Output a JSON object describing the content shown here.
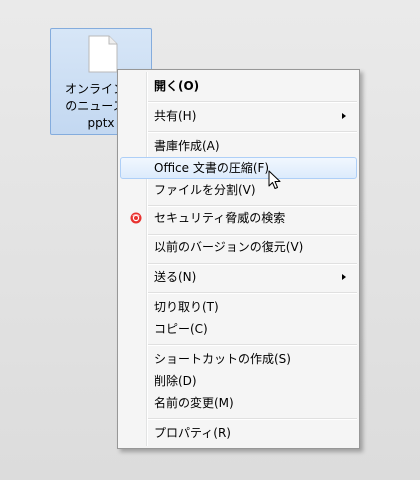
{
  "file": {
    "icon": "document-icon",
    "name_lines": [
      "オンラインソ",
      "のニュースサ",
      "pptx"
    ]
  },
  "context_menu": {
    "items": [
      {
        "label": "開く(O)",
        "bold": true
      },
      {
        "label": "共有(H)",
        "submenu": true
      },
      {
        "label": "書庫作成(A)"
      },
      {
        "label": "Office 文書の圧縮(F)",
        "highlighted": true
      },
      {
        "label": "ファイルを分割(V)"
      },
      {
        "label": "セキュリティ脅威の検索",
        "icon": "security-scan-icon"
      },
      {
        "label": "以前のバージョンの復元(V)"
      },
      {
        "label": "送る(N)",
        "submenu": true
      },
      {
        "label": "切り取り(T)"
      },
      {
        "label": "コピー(C)"
      },
      {
        "label": "ショートカットの作成(S)"
      },
      {
        "label": "削除(D)"
      },
      {
        "label": "名前の変更(M)"
      },
      {
        "label": "プロパティ(R)"
      }
    ]
  },
  "colors": {
    "menu_background": "#f5f5f5",
    "hover_border": "#aecff7",
    "selection_fill": "#c3d8f1",
    "scan_icon": "#e8322f"
  },
  "cursor": "arrow-pointer-icon"
}
